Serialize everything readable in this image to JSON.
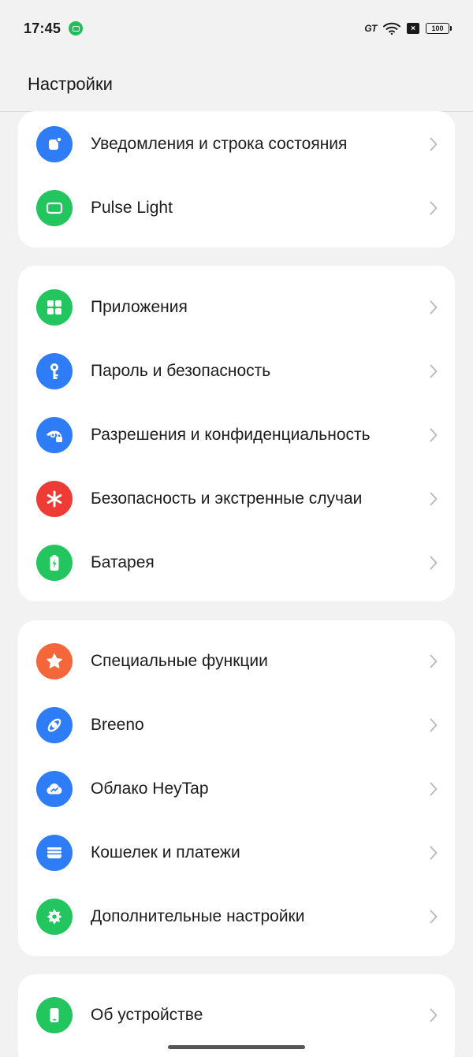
{
  "status_bar": {
    "time": "17:45",
    "network_badge": "GT",
    "x_badge": "×",
    "battery": "100"
  },
  "header": {
    "title": "Настройки"
  },
  "cards": [
    {
      "items": [
        {
          "label": "Уведомления и строка состояния",
          "icon": "notification-icon",
          "color": "#2e7cf6"
        },
        {
          "label": "Pulse Light",
          "icon": "pulse-light-icon",
          "color": "#22c55e"
        }
      ]
    },
    {
      "items": [
        {
          "label": "Приложения",
          "icon": "apps-grid-icon",
          "color": "#22c55e"
        },
        {
          "label": "Пароль и безопасность",
          "icon": "key-icon",
          "color": "#2e7cf6"
        },
        {
          "label": "Разрешения и конфиденциальность",
          "icon": "privacy-eye-icon",
          "color": "#2e7cf6"
        },
        {
          "label": "Безопасность и экстренные случаи",
          "icon": "emergency-asterisk-icon",
          "color": "#ef3b35"
        },
        {
          "label": "Батарея",
          "icon": "battery-icon",
          "color": "#22c55e"
        }
      ]
    },
    {
      "items": [
        {
          "label": "Специальные функции",
          "icon": "star-icon",
          "color": "#f5673a"
        },
        {
          "label": "Breeno",
          "icon": "breeno-icon",
          "color": "#2e7cf6"
        },
        {
          "label": "Облако HeyTap",
          "icon": "cloud-icon",
          "color": "#2e7cf6"
        },
        {
          "label": "Кошелек и платежи",
          "icon": "wallet-icon",
          "color": "#2e7cf6"
        },
        {
          "label": "Дополнительные настройки",
          "icon": "gear-icon",
          "color": "#22c55e"
        }
      ]
    },
    {
      "items": [
        {
          "label": "Об устройстве",
          "icon": "phone-icon",
          "color": "#22c55e"
        }
      ]
    }
  ]
}
